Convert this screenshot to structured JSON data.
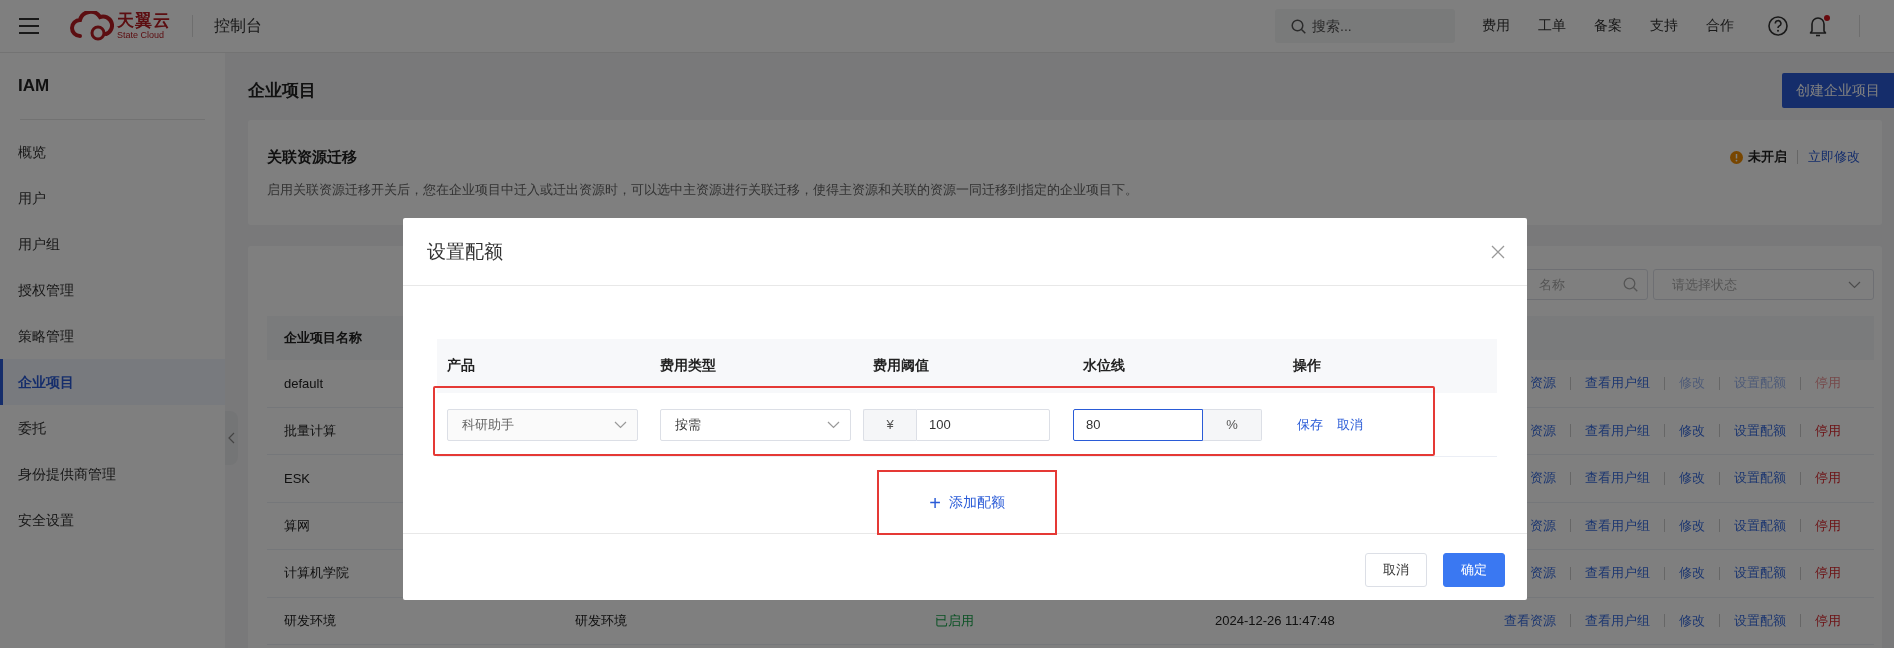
{
  "top_bar": {
    "brand": {
      "name": "天翼云",
      "subtitle": "State Cloud"
    },
    "console_label": "控制台",
    "search": {
      "placeholder": "搜索..."
    },
    "links": [
      "费用",
      "工单",
      "备案",
      "支持",
      "合作"
    ],
    "notifications_unread": true
  },
  "sidebar": {
    "title": "IAM",
    "items": [
      {
        "label": "概览",
        "selected": false
      },
      {
        "label": "用户",
        "selected": false
      },
      {
        "label": "用户组",
        "selected": false
      },
      {
        "label": "授权管理",
        "selected": false
      },
      {
        "label": "策略管理",
        "selected": false
      },
      {
        "label": "企业项目",
        "selected": true
      },
      {
        "label": "委托",
        "selected": false
      },
      {
        "label": "身份提供商管理",
        "selected": false
      },
      {
        "label": "安全设置",
        "selected": false
      }
    ]
  },
  "page": {
    "title": "企业项目",
    "create_button": "创建企业项目"
  },
  "migration_card": {
    "title": "关联资源迁移",
    "description": "启用关联资源迁移开关后，您在企业项目中迁入或迁出资源时，可以选中主资源进行关联迁移，使得主资源和关联的资源一同迁移到指定的企业项目下。",
    "status": "未开启",
    "action": "立即修改"
  },
  "project_table": {
    "search": {
      "placeholder": "名称"
    },
    "status_filter": {
      "placeholder": "请选择状态"
    },
    "columns": [
      "企业项目名称"
    ],
    "rows": [
      {
        "name": "default",
        "actions": [
          {
            "label": "资源",
            "kind": "link",
            "disabled": false
          },
          {
            "label": "查看用户组",
            "kind": "link",
            "disabled": false
          },
          {
            "label": "修改",
            "kind": "link",
            "disabled": true
          },
          {
            "label": "设置配额",
            "kind": "link",
            "disabled": true
          },
          {
            "label": "停用",
            "kind": "danger",
            "disabled": true
          }
        ]
      },
      {
        "name": "批量计算",
        "actions": [
          {
            "label": "资源",
            "kind": "link",
            "disabled": false
          },
          {
            "label": "查看用户组",
            "kind": "link",
            "disabled": false
          },
          {
            "label": "修改",
            "kind": "link",
            "disabled": false
          },
          {
            "label": "设置配额",
            "kind": "link",
            "disabled": false
          },
          {
            "label": "停用",
            "kind": "danger",
            "disabled": false
          }
        ]
      },
      {
        "name": "ESK",
        "actions": [
          {
            "label": "资源",
            "kind": "link",
            "disabled": false
          },
          {
            "label": "查看用户组",
            "kind": "link",
            "disabled": false
          },
          {
            "label": "修改",
            "kind": "link",
            "disabled": false
          },
          {
            "label": "设置配额",
            "kind": "link",
            "disabled": false
          },
          {
            "label": "停用",
            "kind": "danger",
            "disabled": false
          }
        ]
      },
      {
        "name": "算网",
        "actions": [
          {
            "label": "资源",
            "kind": "link",
            "disabled": false
          },
          {
            "label": "查看用户组",
            "kind": "link",
            "disabled": false
          },
          {
            "label": "修改",
            "kind": "link",
            "disabled": false
          },
          {
            "label": "设置配额",
            "kind": "link",
            "disabled": false
          },
          {
            "label": "停用",
            "kind": "danger",
            "disabled": false
          }
        ]
      },
      {
        "name": "计算机学院",
        "actions": [
          {
            "label": "资源",
            "kind": "link",
            "disabled": false
          },
          {
            "label": "查看用户组",
            "kind": "link",
            "disabled": false
          },
          {
            "label": "修改",
            "kind": "link",
            "disabled": false
          },
          {
            "label": "设置配额",
            "kind": "link",
            "disabled": false
          },
          {
            "label": "停用",
            "kind": "danger",
            "disabled": false
          }
        ]
      },
      {
        "name": "研发环境",
        "column_2": "研发环境",
        "column_3": "已启用",
        "column_4": "2024-12-26 11:47:48",
        "actions": [
          {
            "label": "查看资源",
            "kind": "link",
            "disabled": false
          },
          {
            "label": "查看用户组",
            "kind": "link",
            "disabled": false
          },
          {
            "label": "修改",
            "kind": "link",
            "disabled": false
          },
          {
            "label": "设置配额",
            "kind": "link",
            "disabled": false
          },
          {
            "label": "停用",
            "kind": "danger",
            "disabled": false
          }
        ]
      }
    ]
  },
  "quota_dialog": {
    "title": "设置配额",
    "columns": [
      "产品",
      "费用类型",
      "费用阈值",
      "水位线",
      "操作"
    ],
    "rows": [
      {
        "highlighted": true,
        "product": {
          "value": "科研助手",
          "disabled": true
        },
        "fee_type": {
          "value": "按需",
          "disabled": false
        },
        "threshold": {
          "prefix": "¥",
          "value": "100"
        },
        "watermark": {
          "value": "80",
          "suffix": "%",
          "focused": true
        },
        "actions": [
          "保存",
          "取消"
        ]
      }
    ],
    "add_button": {
      "icon": "+",
      "label": "添加配额",
      "highlighted": true
    },
    "buttons": [
      {
        "label": "取消",
        "kind": "secondary"
      },
      {
        "label": "确定",
        "kind": "primary"
      }
    ]
  }
}
